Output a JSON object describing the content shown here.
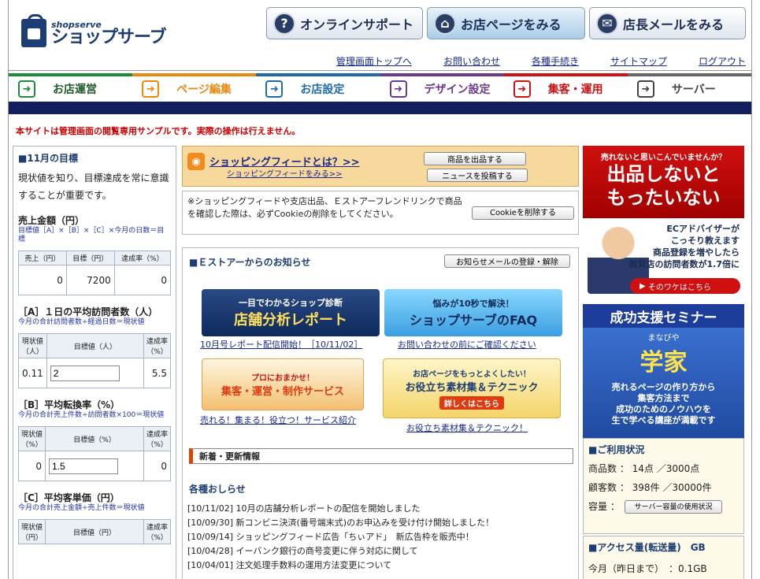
{
  "logo": {
    "en": "shopserve",
    "jp": "ショップサーブ"
  },
  "top_buttons": [
    {
      "label": "オンラインサポート",
      "icon": "question-icon"
    },
    {
      "label": "お店ページをみる",
      "icon": "shop-icon"
    },
    {
      "label": "店長メールをみる",
      "icon": "mail-icon"
    }
  ],
  "top_links": [
    "管理画面トップへ",
    "お問い合わせ",
    "各種手続き",
    "サイトマップ",
    "ログアウト"
  ],
  "nav": [
    {
      "label": "お店運営",
      "color": "#1f8a3a"
    },
    {
      "label": "ページ編集",
      "color": "#e88a12"
    },
    {
      "label": "お店設定",
      "color": "#1f6aa8"
    },
    {
      "label": "デザイン設定",
      "color": "#6a3a8a"
    },
    {
      "label": "集客・運用",
      "color": "#c81414"
    },
    {
      "label": "サーバー",
      "color": "#444444"
    }
  ],
  "notice": "本サイトは管理画面の閲覧専用サンプルです。実際の操作は行えません。",
  "goal": {
    "title": "■11月の目標",
    "intro": "現状値を知り、目標達成を常に意識することが重要です。",
    "sales": {
      "label": "売上金額（円）",
      "formula": "目標値［A］×［B］×［C］×今月の日数＝目標",
      "headers": [
        "売上（円）",
        "目標（円）",
        "達成率（%）"
      ],
      "values": [
        "0",
        "7200",
        "0"
      ]
    },
    "a": {
      "label": "［A］１日の平均訪問者数（人）",
      "formula": "今月の合計訪問者数÷経過日数＝現状値",
      "headers": [
        "現状値（人）",
        "目標値（人）",
        "達成率（%）"
      ],
      "current": "0.11",
      "target": "2",
      "rate": "5.5"
    },
    "b": {
      "label": "［B］平均転換率（%）",
      "formula": "今月の合計売上件数÷訪問者数×100＝現状値",
      "headers": [
        "現状値（%）",
        "目標値（%）",
        "達成率（%）"
      ],
      "current": "0",
      "target": "1.5",
      "rate": "0"
    },
    "c": {
      "label": "［C］平均客単価（円）",
      "formula": "今月の合計売上金額÷売上件数＝現状値",
      "headers": [
        "現状値（円）",
        "目標値（円）",
        "達成率（%）"
      ]
    }
  },
  "feed": {
    "title": "ショッピングフィードとは？>>",
    "sub": "ショッピングフィードをみる>>",
    "btn_product": "商品を出品する",
    "btn_news": "ニュースを投稿する"
  },
  "cookie": {
    "text": "※ショッピングフィードや支店出品、Ｅストアーフレンドリンクで商品を確認した際は、必ずCookieの削除をしてください。",
    "btn": "Cookieを削除する"
  },
  "news": {
    "head": "■Ｅストアーからのお知らせ",
    "btn_mail": "お知らせメールの登録・解除",
    "banners": [
      {
        "top": "一目でわかるショップ診断",
        "main": "店舗分析レポート",
        "link": "10月号レポート配信開始！［10/11/02］"
      },
      {
        "top": "悩みが10秒で解決！",
        "main": "ショップサーブのFAQ",
        "link": "お問い合わせの前にご確認ください"
      },
      {
        "top": "プロにおまかせ！",
        "main": "集客・運営・制作サービス",
        "link": "売れる！集まる！役立つ！サービス紹介"
      },
      {
        "top": "お店ページをもっとよくしたい！",
        "main": "お役立ち素材集＆テクニック",
        "badge": "詳しくはこちら",
        "link": "お役立ち素材集＆テクニック！"
      }
    ],
    "subhead": "新着・更新情報",
    "kakushu": "各種おしらせ",
    "items": [
      "[10/11/02] 10月の店舗分析レポートの配信を開始しました",
      "[10/09/30] 新コンビニ決済(番号端末式)のお申込みを受け付け開始しました！",
      "[10/09/14] ショッピングフィード広告「ちぃアド」　新広告枠を販売中！",
      "[10/04/28] イーバンク銀行の商号変更に伴う対応に関して",
      "[10/04/01] 注文処理手数料の運用方法変更について"
    ]
  },
  "ad1": {
    "q": "売れないと思いこんでいませんか？",
    "big1": "出品しないと",
    "big2": "もったいない",
    "t1": "ECアドバイザーが",
    "t2": "こっそり教えます",
    "t3": "商品登録を増やしたら",
    "t4": "雑貨店の訪問者数が1.7倍に",
    "btn": "そのワケはこちら"
  },
  "ad2": {
    "title": "成功支援セミナー",
    "small": "まなびや",
    "gaku": "学家",
    "l1": "売れるページの作り方から",
    "l2": "集客方法まで",
    "l3": "成功のためのノウハウを",
    "l4": "生で学べる講座が満載です"
  },
  "usage": {
    "title": "■ご利用状況",
    "products": "商品数 ： 14点 ／3000点",
    "customers": "顧客数 ： 398件 ／30000件",
    "capacity": "容量 ：",
    "btn": "サーバー容量の使用状況"
  },
  "access": {
    "title": "■アクセス量(転送量)　GB",
    "month": "今月（昨日まで）　：0.1GB"
  }
}
